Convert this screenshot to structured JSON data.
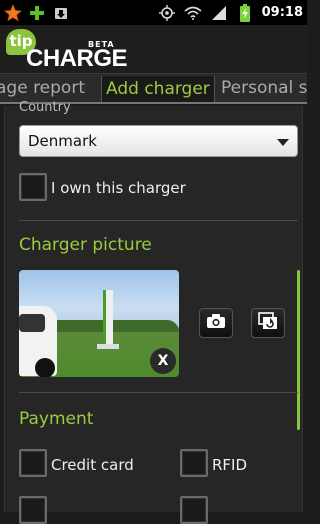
{
  "status_bar": {
    "time": "09:18",
    "left_icons": [
      "star-icon",
      "plus-icon",
      "download-icon"
    ],
    "right_icons": [
      "gps-icon",
      "wifi-icon",
      "signal-icon",
      "battery-charging-icon"
    ]
  },
  "app": {
    "logo_tip": "tip",
    "logo_charge": "CHARGE",
    "logo_beta": "BETA"
  },
  "tabs": [
    {
      "label": "age report",
      "active": false
    },
    {
      "label": "Add charger",
      "active": true
    },
    {
      "label": "Personal s",
      "active": false
    }
  ],
  "form": {
    "country_label": "Country",
    "country_value": "Denmark",
    "own_charger_label": "I own this charger",
    "own_charger_checked": false,
    "picture_section_title": "Charger picture",
    "remove_photo_label": "X",
    "payment_section_title": "Payment",
    "payment_options": [
      {
        "label": "Credit card",
        "checked": false
      },
      {
        "label": "RFID",
        "checked": false
      }
    ]
  },
  "colors": {
    "accent": "#9ccc3c",
    "background": "#262626",
    "status_bar": "#000000"
  }
}
